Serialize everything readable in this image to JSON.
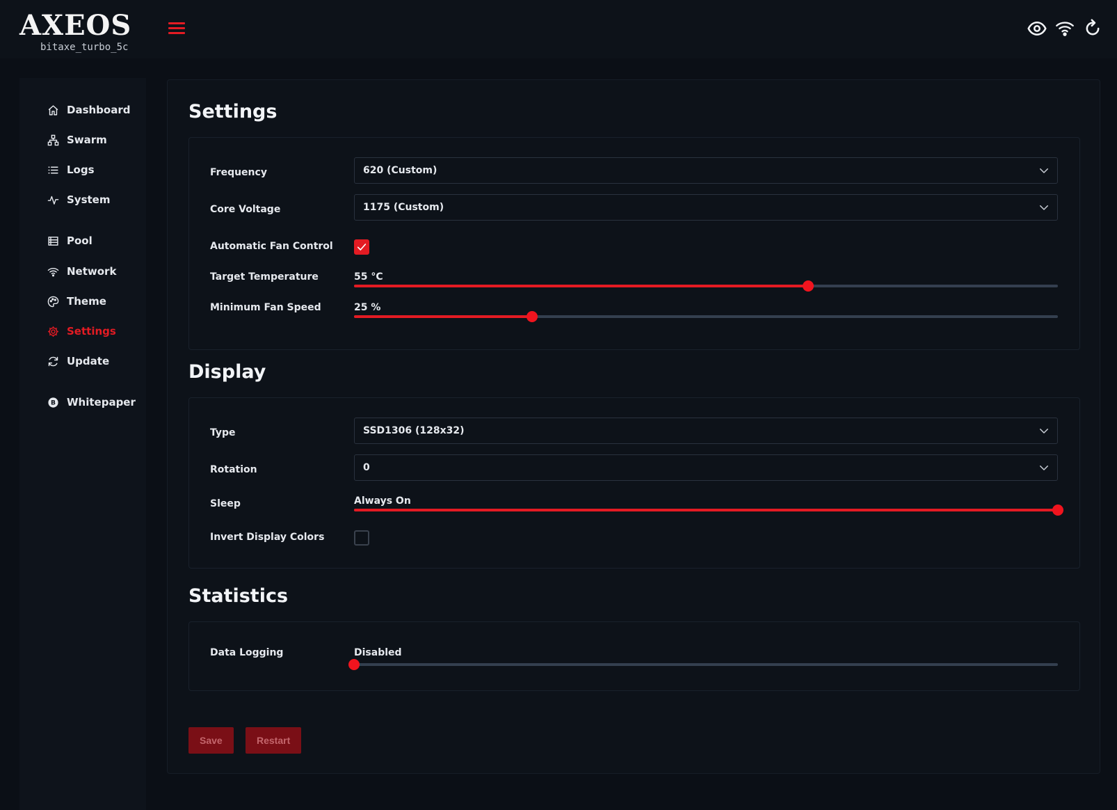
{
  "app": {
    "logo_text": "AXEOS",
    "hostname": "bitaxe_turbo_5c"
  },
  "topbar": {
    "icons": [
      "eye-icon",
      "wifi-icon",
      "refresh-icon"
    ]
  },
  "sidebar": {
    "items": [
      {
        "label": "Dashboard",
        "icon": "home-icon"
      },
      {
        "label": "Swarm",
        "icon": "sitemap-icon"
      },
      {
        "label": "Logs",
        "icon": "list-icon"
      },
      {
        "label": "System",
        "icon": "pulse-icon"
      },
      {
        "label": "Pool",
        "icon": "server-icon"
      },
      {
        "label": "Network",
        "icon": "wifi-icon"
      },
      {
        "label": "Theme",
        "icon": "palette-icon"
      },
      {
        "label": "Settings",
        "icon": "gear-icon",
        "active": true
      },
      {
        "label": "Update",
        "icon": "sync-icon"
      },
      {
        "label": "Whitepaper",
        "icon": "bitcoin-icon"
      }
    ]
  },
  "settings": {
    "title": "Settings",
    "frequency": {
      "label": "Frequency",
      "value": "620 (Custom)"
    },
    "core_voltage": {
      "label": "Core Voltage",
      "value": "1175 (Custom)"
    },
    "auto_fan": {
      "label": "Automatic Fan Control",
      "checked": true
    },
    "target_temp": {
      "label": "Target Temperature",
      "value_text": "55 °C",
      "fraction": 0.645
    },
    "min_fan": {
      "label": "Minimum Fan Speed",
      "value_text": "25 %",
      "fraction": 0.253
    }
  },
  "display": {
    "title": "Display",
    "type": {
      "label": "Type",
      "value": "SSD1306 (128x32)"
    },
    "rotation": {
      "label": "Rotation",
      "value": "0"
    },
    "sleep": {
      "label": "Sleep",
      "value_text": "Always On",
      "fraction": 1.0
    },
    "invert": {
      "label": "Invert Display Colors",
      "checked": false
    }
  },
  "statistics": {
    "title": "Statistics",
    "data_logging": {
      "label": "Data Logging",
      "value_text": "Disabled",
      "fraction": 0.0
    }
  },
  "actions": {
    "save_label": "Save",
    "restart_label": "Restart"
  },
  "colors": {
    "accent": "#e31b23",
    "background": "#0b0f16",
    "panel": "#0d1219",
    "track": "#343f4f",
    "button_disabled": "#7a0f16"
  }
}
